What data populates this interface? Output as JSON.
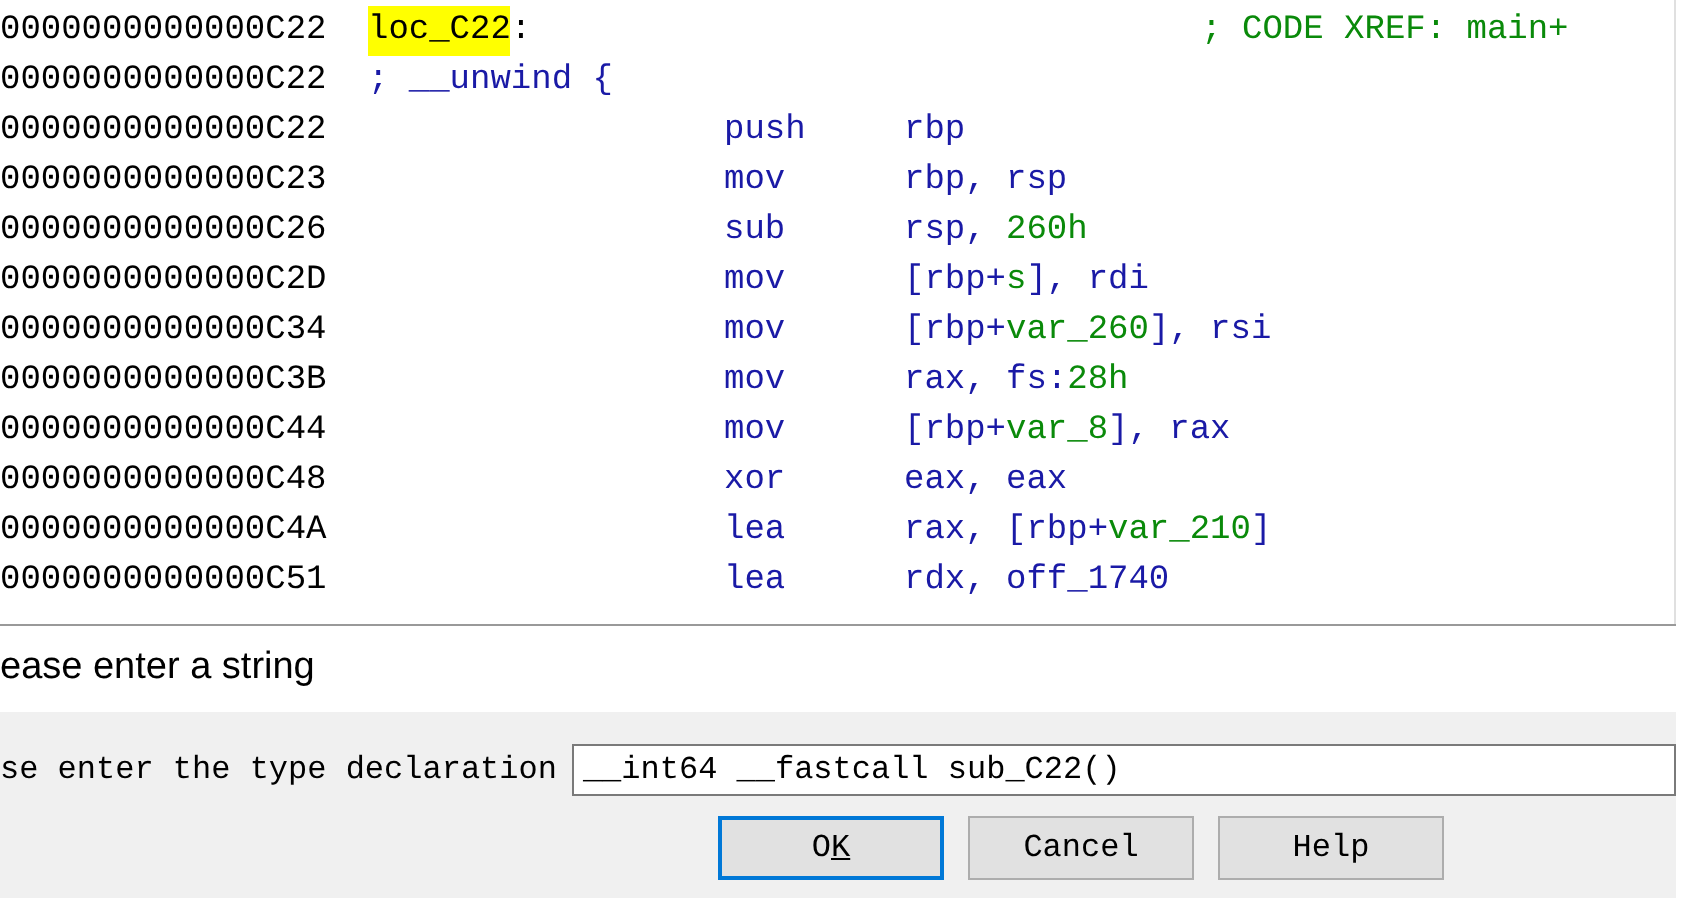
{
  "listing": [
    {
      "address": "0000000000000C22",
      "kind": "label",
      "label": "loc_C22",
      "suffix": ":",
      "comment": "; CODE XREF: main+"
    },
    {
      "address": "0000000000000C22",
      "kind": "directive",
      "text": "; __unwind {"
    },
    {
      "address": "0000000000000C22",
      "kind": "instruction",
      "mnemonic": "push",
      "operands": [
        {
          "kind": "reg",
          "text": "rbp"
        }
      ]
    },
    {
      "address": "0000000000000C23",
      "kind": "instruction",
      "mnemonic": "mov",
      "operands": [
        {
          "kind": "reg",
          "text": "rbp, rsp"
        }
      ]
    },
    {
      "address": "0000000000000C26",
      "kind": "instruction",
      "mnemonic": "sub",
      "operands": [
        {
          "kind": "reg",
          "text": "rsp, "
        },
        {
          "kind": "num",
          "text": "260h"
        }
      ]
    },
    {
      "address": "0000000000000C2D",
      "kind": "instruction",
      "mnemonic": "mov",
      "operands": [
        {
          "kind": "reg",
          "text": "[rbp+"
        },
        {
          "kind": "num",
          "text": "s"
        },
        {
          "kind": "reg",
          "text": "], rdi"
        }
      ]
    },
    {
      "address": "0000000000000C34",
      "kind": "instruction",
      "mnemonic": "mov",
      "operands": [
        {
          "kind": "reg",
          "text": "[rbp+"
        },
        {
          "kind": "num",
          "text": "var_260"
        },
        {
          "kind": "reg",
          "text": "], rsi"
        }
      ]
    },
    {
      "address": "0000000000000C3B",
      "kind": "instruction",
      "mnemonic": "mov",
      "operands": [
        {
          "kind": "reg",
          "text": "rax, fs:"
        },
        {
          "kind": "num",
          "text": "28h"
        }
      ]
    },
    {
      "address": "0000000000000C44",
      "kind": "instruction",
      "mnemonic": "mov",
      "operands": [
        {
          "kind": "reg",
          "text": "[rbp+"
        },
        {
          "kind": "num",
          "text": "var_8"
        },
        {
          "kind": "reg",
          "text": "], rax"
        }
      ]
    },
    {
      "address": "0000000000000C48",
      "kind": "instruction",
      "mnemonic": "xor",
      "operands": [
        {
          "kind": "reg",
          "text": "eax, eax"
        }
      ]
    },
    {
      "address": "0000000000000C4A",
      "kind": "instruction",
      "mnemonic": "lea",
      "operands": [
        {
          "kind": "reg",
          "text": "rax, [rbp+"
        },
        {
          "kind": "num",
          "text": "var_210"
        },
        {
          "kind": "reg",
          "text": "]"
        }
      ]
    },
    {
      "address": "0000000000000C51",
      "kind": "instruction",
      "mnemonic": "lea",
      "operands": [
        {
          "kind": "reg",
          "text": "rdx, off_1740"
        }
      ]
    }
  ],
  "dialog": {
    "title": "ease enter a string",
    "field_label": "se enter the type declaration",
    "field_value": "__int64 __fastcall sub_C22()",
    "buttons": [
      {
        "label": "O",
        "accelerator": "K",
        "default": true
      },
      {
        "label": "Cancel",
        "default": false
      },
      {
        "label": "Help",
        "default": false
      }
    ]
  }
}
